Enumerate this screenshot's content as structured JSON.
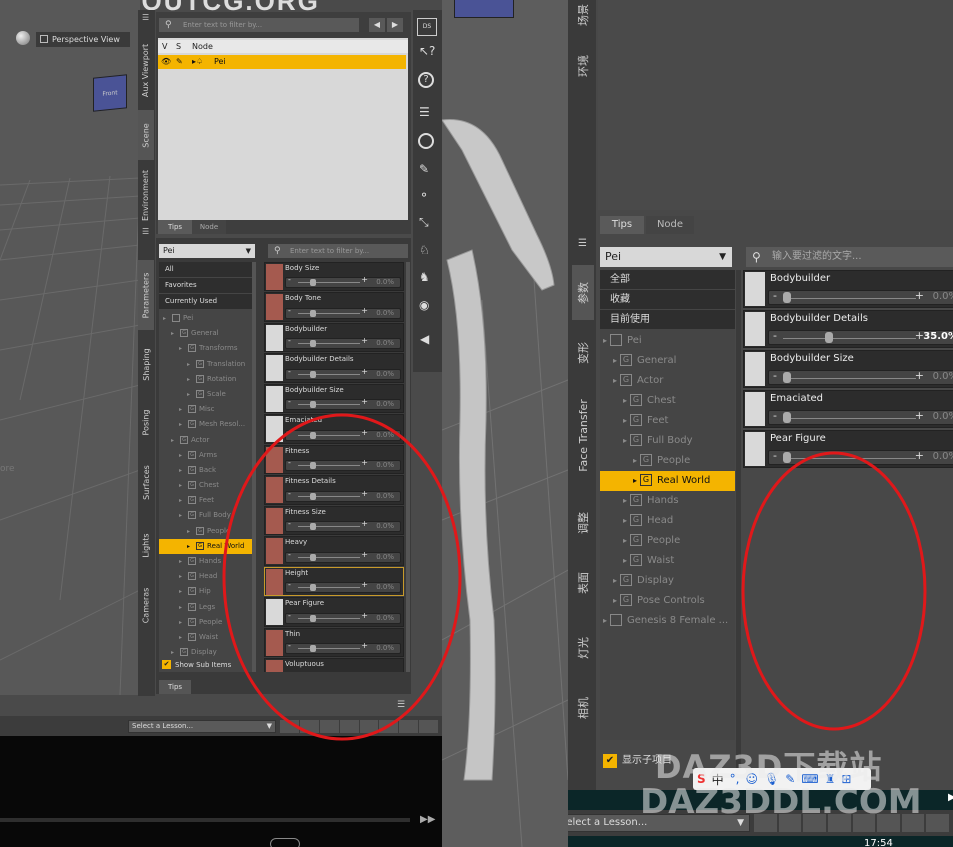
{
  "left_app": {
    "logo": "ABOUTCG.ORG",
    "viewport_label": "Perspective View",
    "cube_label": "Front",
    "side_tabs": [
      "Aux Viewport",
      "Scene",
      "Environment",
      "Parameters",
      "Shaping",
      "Posing",
      "Surfaces",
      "Lights",
      "Cameras"
    ],
    "scene": {
      "filter_placeholder": "Enter text to filter by...",
      "columns": [
        "V",
        "S",
        "Node"
      ],
      "node": "Pei",
      "tabs": [
        "Tips",
        "Node"
      ]
    },
    "params": {
      "selector": "Pei",
      "filter_placeholder": "Enter text to filter by...",
      "categories": [
        "All",
        "Favorites",
        "Currently Used"
      ],
      "tree": [
        {
          "label": "Pei",
          "depth": 0
        },
        {
          "label": "General",
          "depth": 1
        },
        {
          "label": "Transforms",
          "depth": 2
        },
        {
          "label": "Translation",
          "depth": 3
        },
        {
          "label": "Rotation",
          "depth": 3
        },
        {
          "label": "Scale",
          "depth": 3
        },
        {
          "label": "Misc",
          "depth": 2
        },
        {
          "label": "Mesh Resol...",
          "depth": 2
        },
        {
          "label": "Actor",
          "depth": 1
        },
        {
          "label": "Arms",
          "depth": 2
        },
        {
          "label": "Back",
          "depth": 2
        },
        {
          "label": "Chest",
          "depth": 2
        },
        {
          "label": "Feet",
          "depth": 2
        },
        {
          "label": "Full Body",
          "depth": 2
        },
        {
          "label": "People",
          "depth": 3
        },
        {
          "label": "Real World",
          "depth": 3,
          "selected": true
        },
        {
          "label": "Hands",
          "depth": 2
        },
        {
          "label": "Head",
          "depth": 2
        },
        {
          "label": "Hip",
          "depth": 2
        },
        {
          "label": "Legs",
          "depth": 2
        },
        {
          "label": "People",
          "depth": 2
        },
        {
          "label": "Waist",
          "depth": 2
        },
        {
          "label": "Display",
          "depth": 1
        }
      ],
      "show_sub_items": "Show Sub Items",
      "sliders": [
        {
          "name": "Body Size",
          "value": "0.0%",
          "thumb": false
        },
        {
          "name": "Body Tone",
          "value": "0.0%",
          "thumb": false
        },
        {
          "name": "Bodybuilder",
          "value": "0.0%",
          "thumb": true
        },
        {
          "name": "Bodybuilder Details",
          "value": "0.0%",
          "thumb": true
        },
        {
          "name": "Bodybuilder Size",
          "value": "0.0%",
          "thumb": true
        },
        {
          "name": "Emaciated",
          "value": "0.0%",
          "thumb": true
        },
        {
          "name": "Fitness",
          "value": "0.0%",
          "thumb": false
        },
        {
          "name": "Fitness Details",
          "value": "0.0%",
          "thumb": false
        },
        {
          "name": "Fitness Size",
          "value": "0.0%",
          "thumb": false
        },
        {
          "name": "Heavy",
          "value": "0.0%",
          "thumb": false
        },
        {
          "name": "Height",
          "value": "0.0%",
          "thumb": false
        },
        {
          "name": "Pear Figure",
          "value": "0.0%",
          "thumb": true
        },
        {
          "name": "Thin",
          "value": "0.0%",
          "thumb": false
        },
        {
          "name": "Voluptuous",
          "value": "",
          "thumb": false
        }
      ],
      "tips_tab": "Tips",
      "lesson_select": "Select a Lesson...",
      "toolbar_ds": "DS"
    }
  },
  "right_app": {
    "top_tabs": [
      "场景",
      "环境"
    ],
    "side_tabs": [
      "参数",
      "变形",
      "Face Transfer",
      "调整",
      "表面",
      "灯光",
      "相机"
    ],
    "tabs": [
      "Tips",
      "Node"
    ],
    "selector": "Pei",
    "filter_placeholder": "输入要过滤的文字...",
    "categories": [
      "全部",
      "收藏",
      "目前使用"
    ],
    "tree": [
      {
        "label": "Pei",
        "depth": 0
      },
      {
        "label": "General",
        "depth": 1
      },
      {
        "label": "Actor",
        "depth": 1
      },
      {
        "label": "Chest",
        "depth": 2
      },
      {
        "label": "Feet",
        "depth": 2
      },
      {
        "label": "Full Body",
        "depth": 2
      },
      {
        "label": "People",
        "depth": 3
      },
      {
        "label": "Real World",
        "depth": 3,
        "selected": true
      },
      {
        "label": "Hands",
        "depth": 2
      },
      {
        "label": "Head",
        "depth": 2
      },
      {
        "label": "People",
        "depth": 2
      },
      {
        "label": "Waist",
        "depth": 2
      },
      {
        "label": "Display",
        "depth": 1
      },
      {
        "label": "Pose Controls",
        "depth": 1
      },
      {
        "label": "Genesis 8 Female ...",
        "depth": 0
      }
    ],
    "sliders": [
      {
        "name": "Bodybuilder",
        "value": "0.0%",
        "pos": 0.0
      },
      {
        "name": "Bodybuilder Details",
        "value": "35.0%",
        "pos": 0.35
      },
      {
        "name": "Bodybuilder Size",
        "value": "0.0%",
        "pos": 0.0
      },
      {
        "name": "Emaciated",
        "value": "0.0%",
        "pos": 0.0
      },
      {
        "name": "Pear Figure",
        "value": "0.0%",
        "pos": 0.0
      }
    ],
    "show_sub_items": "显示子项目",
    "lesson_select": "Select a Lesson..."
  },
  "watermark": {
    "line1": "DAZ3D下载站",
    "line2": "DAZ3DDL.COM"
  },
  "taskbar": {
    "time": "17:54",
    "ime": "中"
  },
  "colors": {
    "highlight": "#f4b400",
    "red_annotation": "#e0181a"
  }
}
